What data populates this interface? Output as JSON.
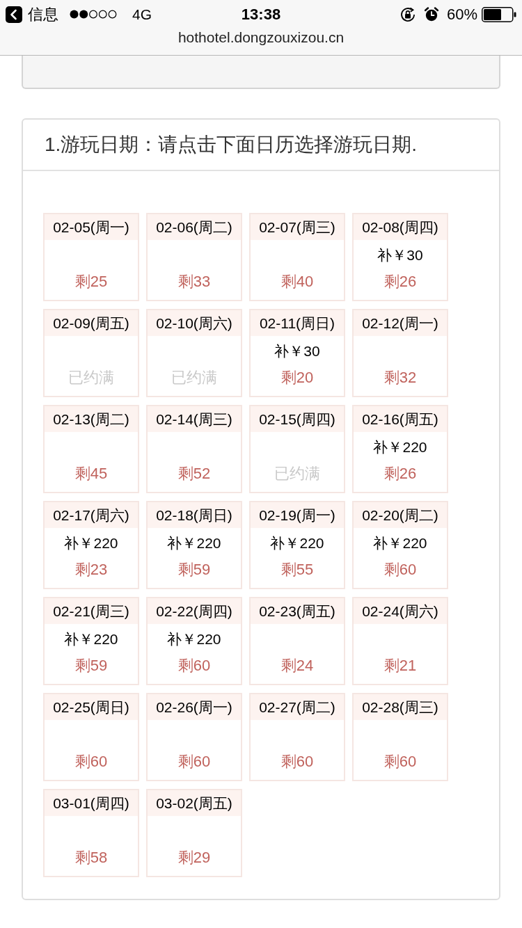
{
  "status_bar": {
    "back_label": "信息",
    "network": "4G",
    "time": "13:38",
    "battery": "60%"
  },
  "address_bar": {
    "url": "hothotel.dongzouxizou.cn"
  },
  "date_section": {
    "title": "1.游玩日期：请点击下面日历选择游玩日期.",
    "days": [
      {
        "date": "02-05(周一)",
        "kind": "open",
        "quota": "剩25"
      },
      {
        "date": "02-06(周二)",
        "kind": "open",
        "quota": "剩33"
      },
      {
        "date": "02-07(周三)",
        "kind": "open",
        "quota": "剩40"
      },
      {
        "date": "02-08(周四)",
        "kind": "open",
        "surcharge": "补￥30",
        "quota": "剩26"
      },
      {
        "date": "02-09(周五)",
        "kind": "full",
        "quota": "已约满"
      },
      {
        "date": "02-10(周六)",
        "kind": "full",
        "quota": "已约满"
      },
      {
        "date": "02-11(周日)",
        "kind": "open",
        "surcharge": "补￥30",
        "quota": "剩20"
      },
      {
        "date": "02-12(周一)",
        "kind": "open",
        "quota": "剩32"
      },
      {
        "date": "02-13(周二)",
        "kind": "open",
        "quota": "剩45"
      },
      {
        "date": "02-14(周三)",
        "kind": "open",
        "quota": "剩52"
      },
      {
        "date": "02-15(周四)",
        "kind": "full",
        "quota": "已约满"
      },
      {
        "date": "02-16(周五)",
        "kind": "open",
        "surcharge": "补￥220",
        "quota": "剩26"
      },
      {
        "date": "02-17(周六)",
        "kind": "open",
        "surcharge": "补￥220",
        "quota": "剩23"
      },
      {
        "date": "02-18(周日)",
        "kind": "open",
        "surcharge": "补￥220",
        "quota": "剩59"
      },
      {
        "date": "02-19(周一)",
        "kind": "open",
        "surcharge": "补￥220",
        "quota": "剩55"
      },
      {
        "date": "02-20(周二)",
        "kind": "open",
        "surcharge": "补￥220",
        "quota": "剩60"
      },
      {
        "date": "02-21(周三)",
        "kind": "open",
        "surcharge": "补￥220",
        "quota": "剩59"
      },
      {
        "date": "02-22(周四)",
        "kind": "open",
        "surcharge": "补￥220",
        "quota": "剩60"
      },
      {
        "date": "02-23(周五)",
        "kind": "open",
        "quota": "剩24"
      },
      {
        "date": "02-24(周六)",
        "kind": "open",
        "quota": "剩21"
      },
      {
        "date": "02-25(周日)",
        "kind": "open",
        "quota": "剩60"
      },
      {
        "date": "02-26(周一)",
        "kind": "open",
        "quota": "剩60"
      },
      {
        "date": "02-27(周二)",
        "kind": "open",
        "quota": "剩60"
      },
      {
        "date": "02-28(周三)",
        "kind": "open",
        "quota": "剩60"
      },
      {
        "date": "03-01(周四)",
        "kind": "open",
        "quota": "剩58"
      },
      {
        "date": "03-02(周五)",
        "kind": "open",
        "quota": "剩29"
      }
    ]
  }
}
